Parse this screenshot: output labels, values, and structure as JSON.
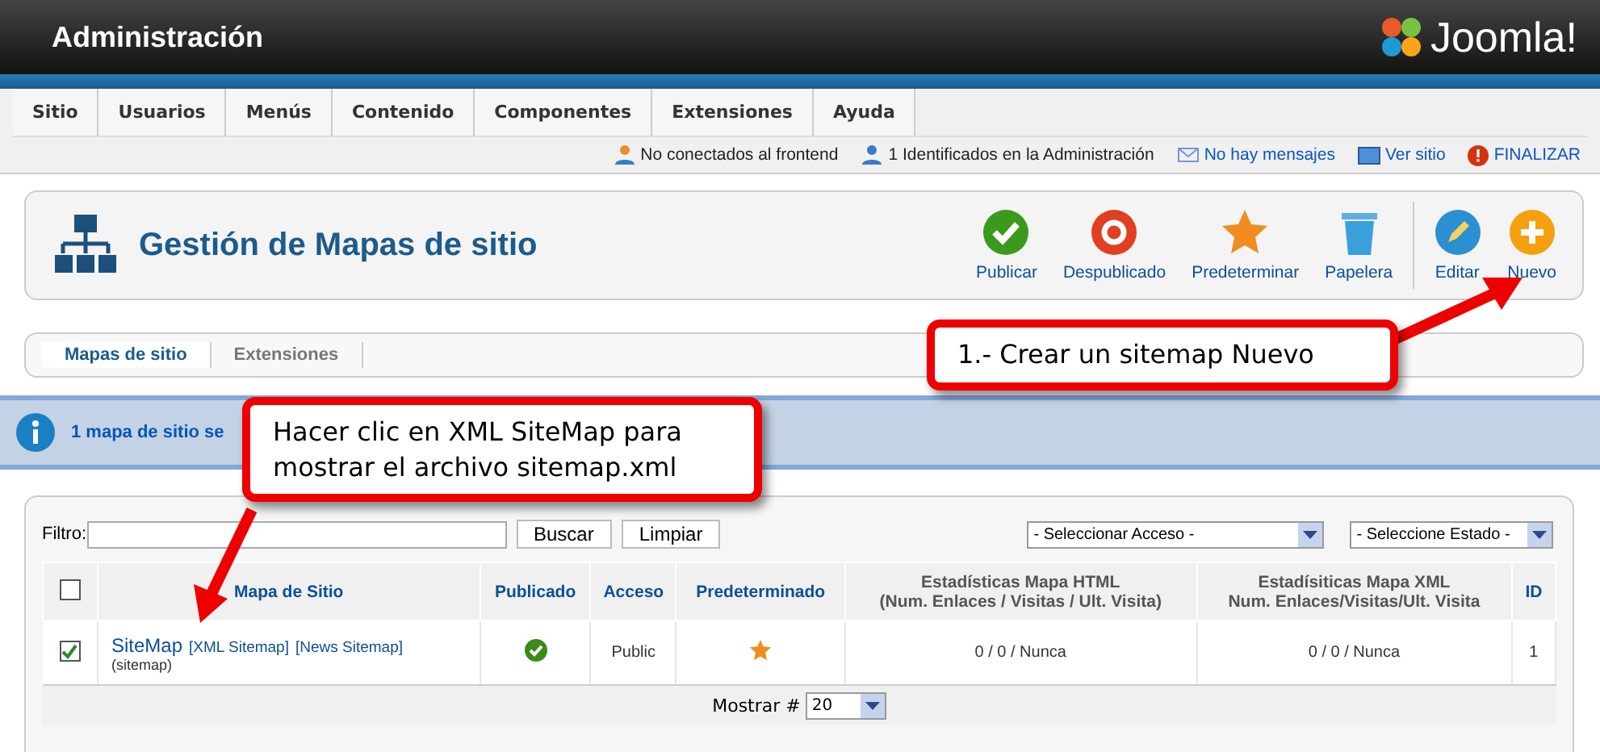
{
  "header": {
    "title": "Administración",
    "logo_text": "Joomla!"
  },
  "menu": [
    "Sitio",
    "Usuarios",
    "Menús",
    "Contenido",
    "Componentes",
    "Extensiones",
    "Ayuda"
  ],
  "status": [
    {
      "kind": "frontend",
      "label": "No conectados al frontend"
    },
    {
      "kind": "admins",
      "label": "1 Identificados en la Administración"
    },
    {
      "kind": "messages",
      "label": "No hay mensajes"
    },
    {
      "kind": "site",
      "label": "Ver sitio"
    },
    {
      "kind": "logout",
      "label": "FINALIZAR"
    }
  ],
  "toolbar": {
    "title": "Gestión de Mapas de sitio",
    "buttons": [
      {
        "kind": "publish",
        "label": "Publicar"
      },
      {
        "kind": "unpublish",
        "label": "Despublicado"
      },
      {
        "kind": "default",
        "label": "Predeterminar"
      },
      {
        "kind": "trash",
        "label": "Papelera"
      },
      {
        "kind": "edit",
        "label": "Editar"
      },
      {
        "kind": "new",
        "label": "Nuevo"
      }
    ]
  },
  "subtabs": [
    {
      "label": "Mapas de sitio",
      "selected": true
    },
    {
      "label": "Extensiones",
      "selected": false
    }
  ],
  "message": "1 mapa de sitio se",
  "filter": {
    "label": "Filtro:",
    "buttons": [
      "Buscar",
      "Limpiar"
    ],
    "selects": [
      "- Seleccionar Acceso -",
      "- Seleccione Estado -"
    ]
  },
  "table": {
    "header_checked": false,
    "columns": [
      "Mapa de Sitio",
      "Publicado",
      "Acceso",
      "Predeterminado",
      "Estadísticas Mapa HTML\n(Num. Enlaces / Visitas / Ult. Visita)",
      "Estadísiticas Mapa XML\nNum. Enlaces/Visitas/Ult. Visita",
      "ID"
    ],
    "rows": [
      {
        "checked": true,
        "name": "SiteMap",
        "links": [
          "[XML Sitemap]",
          "[News Sitemap]"
        ],
        "alias": "(sitemap)",
        "published": true,
        "access": "Public",
        "default": true,
        "html_stats": "0 / 0 / Nunca",
        "xml_stats": "0 / 0 / Nunca",
        "id": "1"
      }
    ]
  },
  "pagination": {
    "label": "Mostrar #",
    "value": "20"
  },
  "callouts": [
    "1.- Crear un sitemap Nuevo",
    "Hacer clic en XML SiteMap para mostrar el archivo sitemap.xml"
  ]
}
